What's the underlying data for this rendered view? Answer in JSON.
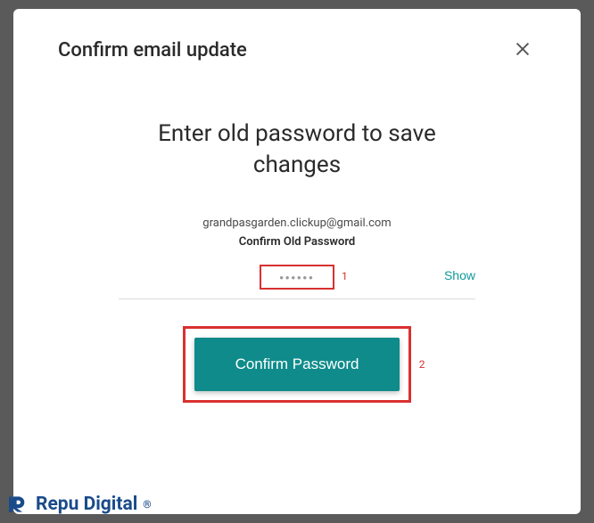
{
  "modal": {
    "title": "Confirm email update",
    "instruction": "Enter old password to save changes",
    "email": "grandpasgarden.clickup@gmail.com",
    "field_label": "Confirm Old Password",
    "password_value": "••••••",
    "show_label": "Show",
    "confirm_label": "Confirm Password"
  },
  "annotations": {
    "step1": "1",
    "step2": "2"
  },
  "brand": {
    "name": "Repu Digital",
    "reg": "®"
  },
  "colors": {
    "accent": "#0f8b8b",
    "annotation": "#d93030",
    "brand": "#1a4b8a"
  }
}
